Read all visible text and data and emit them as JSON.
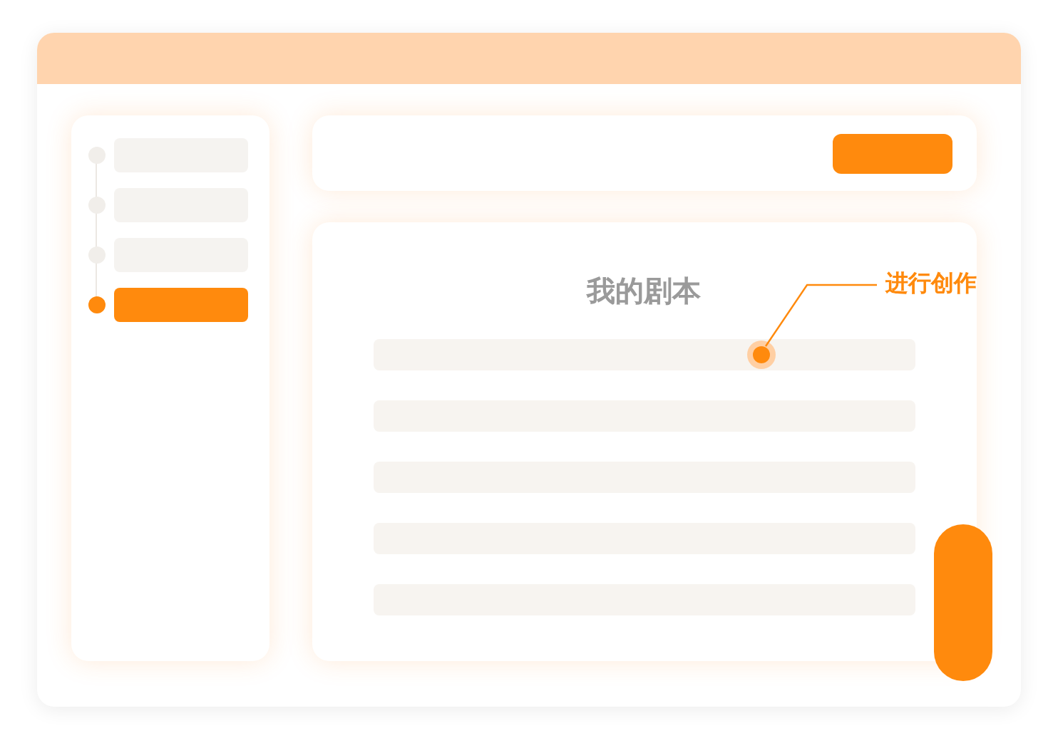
{
  "sidebar": {
    "steps": [
      {
        "selected": false
      },
      {
        "selected": false
      },
      {
        "selected": false
      },
      {
        "selected": true
      }
    ]
  },
  "main": {
    "title": "我的剧本",
    "rows": [
      {
        "selected": true
      },
      {
        "selected": false
      },
      {
        "selected": false
      },
      {
        "selected": false
      },
      {
        "selected": false
      }
    ]
  },
  "callout": {
    "label": "进行创作"
  }
}
